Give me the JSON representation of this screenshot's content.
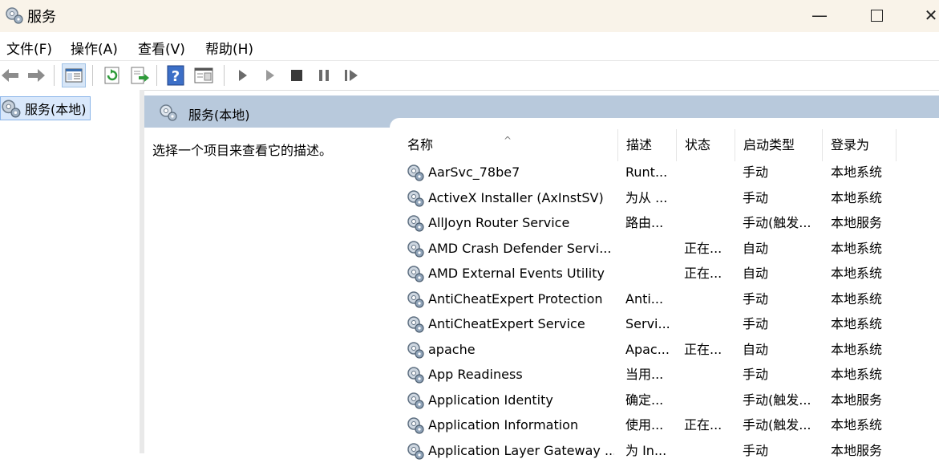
{
  "window": {
    "title": "服务",
    "minimize": "—",
    "close": "✕"
  },
  "menu": [
    "文件(F)",
    "操作(A)",
    "查看(V)",
    "帮助(H)"
  ],
  "tree": {
    "label": "服务(本地)"
  },
  "panel": {
    "title": "服务(本地)",
    "description": "选择一个项目来查看它的描述。"
  },
  "columns": [
    "名称",
    "描述",
    "状态",
    "启动类型",
    "登录为"
  ],
  "services": [
    {
      "name": "AarSvc_78be7",
      "desc": "Runt...",
      "status": "",
      "startup": "手动",
      "logon": "本地系统"
    },
    {
      "name": "ActiveX Installer (AxInstSV)",
      "desc": "为从 ...",
      "status": "",
      "startup": "手动",
      "logon": "本地系统"
    },
    {
      "name": "AllJoyn Router Service",
      "desc": "路由...",
      "status": "",
      "startup": "手动(触发...",
      "logon": "本地服务"
    },
    {
      "name": "AMD Crash Defender Servi...",
      "desc": "",
      "status": "正在...",
      "startup": "自动",
      "logon": "本地系统"
    },
    {
      "name": "AMD External Events Utility",
      "desc": "",
      "status": "正在...",
      "startup": "自动",
      "logon": "本地系统"
    },
    {
      "name": "AntiCheatExpert Protection",
      "desc": "Anti...",
      "status": "",
      "startup": "手动",
      "logon": "本地系统"
    },
    {
      "name": "AntiCheatExpert Service",
      "desc": "Servi...",
      "status": "",
      "startup": "手动",
      "logon": "本地系统"
    },
    {
      "name": "apache",
      "desc": "Apac...",
      "status": "正在...",
      "startup": "自动",
      "logon": "本地系统"
    },
    {
      "name": "App Readiness",
      "desc": "当用...",
      "status": "",
      "startup": "手动",
      "logon": "本地系统"
    },
    {
      "name": "Application Identity",
      "desc": "确定...",
      "status": "",
      "startup": "手动(触发...",
      "logon": "本地服务"
    },
    {
      "name": "Application Information",
      "desc": "使用...",
      "status": "正在...",
      "startup": "手动(触发...",
      "logon": "本地系统"
    },
    {
      "name": "Application Layer Gateway ...",
      "desc": "为 In...",
      "status": "",
      "startup": "手动",
      "logon": "本地服务"
    }
  ],
  "icons": {
    "app": "gears-icon",
    "back": "back-arrow-icon",
    "forward": "forward-arrow-icon",
    "start": "play-icon",
    "stop": "stop-icon",
    "pause": "pause-icon",
    "restart": "restart-icon"
  }
}
